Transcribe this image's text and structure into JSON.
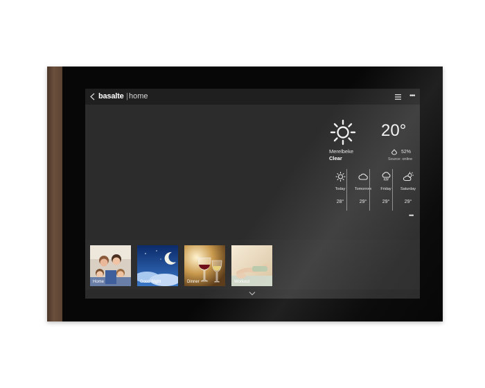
{
  "header": {
    "brand": "basalte",
    "separator": "|",
    "page": "home"
  },
  "weather": {
    "temperature": "20°",
    "city": "Merelbeke",
    "condition": "Clear",
    "humidity": "52%",
    "source": "Source: online",
    "forecast": [
      {
        "day": "Today",
        "temp": "28°",
        "icon": "sun-icon"
      },
      {
        "day": "Tomorrow",
        "temp": "29°",
        "icon": "cloud-icon"
      },
      {
        "day": "Friday",
        "temp": "29°",
        "icon": "rain-cloud-icon"
      },
      {
        "day": "Saturday",
        "temp": "29°",
        "icon": "partly-cloudy-icon"
      }
    ]
  },
  "scenes": [
    {
      "label": "Home"
    },
    {
      "label": "Good Night"
    },
    {
      "label": "Dinner"
    },
    {
      "label": "Workout"
    }
  ],
  "colors": {
    "screen_bg": "#2b2b2b",
    "topbar_bg": "#1f1f1f",
    "bezel": "#070707",
    "bronze": "#6b4f3c"
  }
}
